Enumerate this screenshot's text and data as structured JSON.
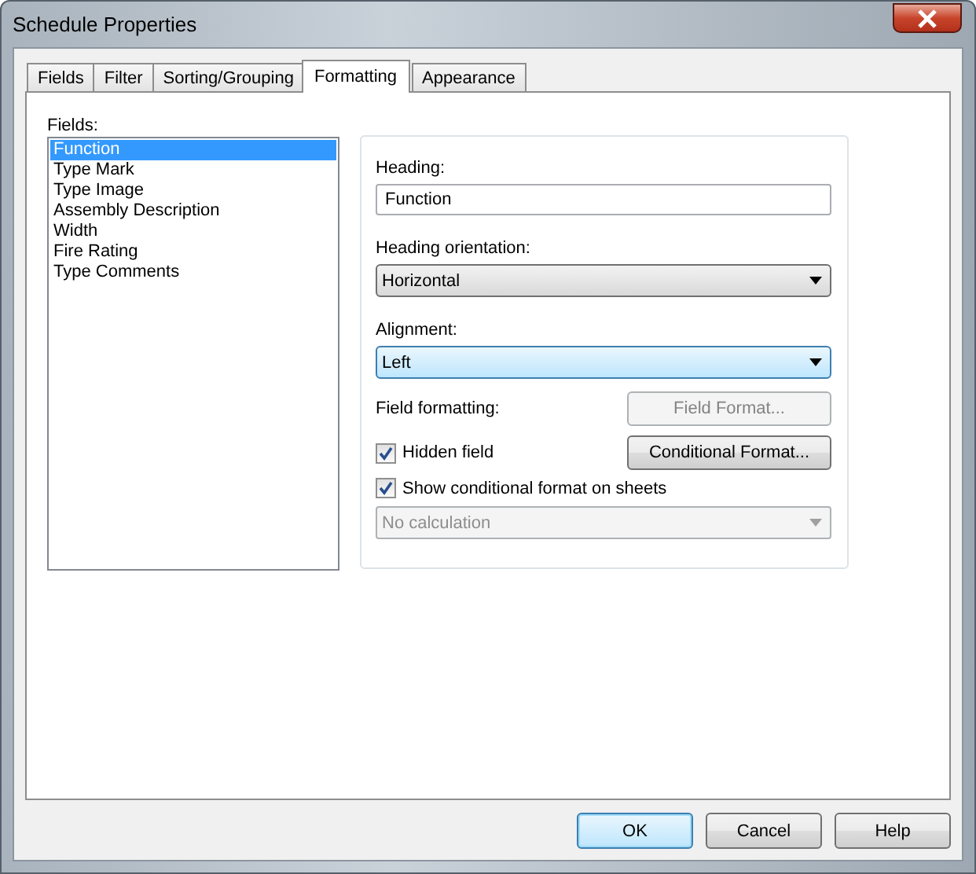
{
  "window": {
    "title": "Schedule Properties"
  },
  "tabs": [
    {
      "label": "Fields",
      "selected": false
    },
    {
      "label": "Filter",
      "selected": false
    },
    {
      "label": "Sorting/Grouping",
      "selected": false
    },
    {
      "label": "Formatting",
      "selected": true
    },
    {
      "label": "Appearance",
      "selected": false
    }
  ],
  "fields": {
    "label": "Fields:",
    "items": [
      {
        "label": "Function",
        "selected": true
      },
      {
        "label": "Type Mark",
        "selected": false
      },
      {
        "label": "Type Image",
        "selected": false
      },
      {
        "label": "Assembly Description",
        "selected": false
      },
      {
        "label": "Width",
        "selected": false
      },
      {
        "label": "Fire Rating",
        "selected": false
      },
      {
        "label": "Type Comments",
        "selected": false
      }
    ]
  },
  "heading": {
    "label": "Heading:",
    "value": "Function"
  },
  "heading_orientation": {
    "label": "Heading orientation:",
    "value": "Horizontal",
    "focused": false,
    "disabled": false
  },
  "alignment": {
    "label": "Alignment:",
    "value": "Left",
    "focused": true,
    "disabled": false
  },
  "field_formatting": {
    "label": "Field formatting:",
    "button": {
      "label": "Field Format...",
      "disabled": true
    }
  },
  "hidden_field": {
    "label": "Hidden field",
    "checked": true
  },
  "conditional_format_button": {
    "label": "Conditional  Format...",
    "disabled": false
  },
  "show_conditional_format": {
    "label": "Show conditional format on sheets",
    "checked": true
  },
  "calculation": {
    "value": "No calculation",
    "disabled": true
  },
  "buttons": [
    {
      "label": "OK",
      "default": true
    },
    {
      "label": "Cancel",
      "default": false
    },
    {
      "label": "Help",
      "default": false
    }
  ]
}
